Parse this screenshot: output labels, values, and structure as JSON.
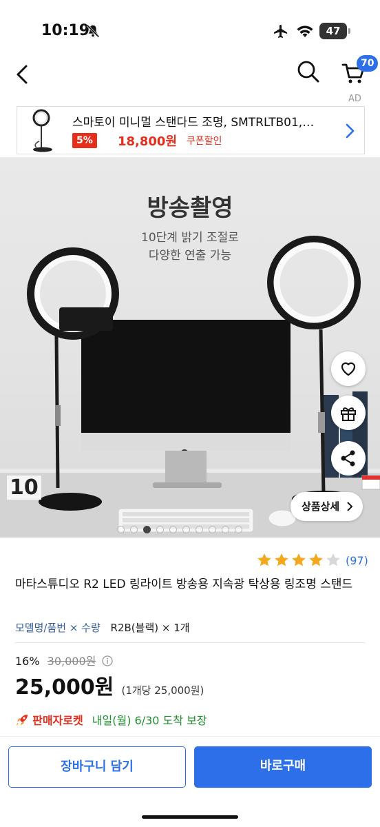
{
  "status_bar": {
    "time": "10:19",
    "battery": "47"
  },
  "nav": {
    "cart_count": "70",
    "ad_label": "AD"
  },
  "ad_banner": {
    "title": "스마토이 미니멀 스탠다드 조명, SMTRLTB01,…",
    "discount": "5%",
    "price": "18,800원",
    "coupon": "쿠폰할인"
  },
  "hero": {
    "title": "방송촬영",
    "subtitle_line1": "10단계 밝기 조절로",
    "subtitle_line2": "다양한 연출 가능",
    "counter_text": "10",
    "detail_button": "상품상세",
    "image_count": 10,
    "active_image": 2
  },
  "rating": {
    "stars": 4,
    "max": 5,
    "count": "(97)"
  },
  "product": {
    "title": "마타스튜디오 R2 LED 링라이트 방송용 지속광 탁상용 링조명 스탠드",
    "option_label": "모델명/품번 × 수량",
    "option_value": "R2B(블랙) × 1개",
    "discount_rate": "16%",
    "original_price": "30,000원",
    "price": "25,000원",
    "unit_price": "(1개당 25,000원)"
  },
  "delivery": {
    "badge": "판매자로켓",
    "arrival": "내일(월) 6/30 도착 보장"
  },
  "buttons": {
    "cart": "장바구니 담기",
    "buy": "바로구매"
  },
  "colors": {
    "accent": "#2c6fe8",
    "sale": "#e62e1c",
    "delivery": "#1e8f2e",
    "star": "#f4a81d"
  }
}
